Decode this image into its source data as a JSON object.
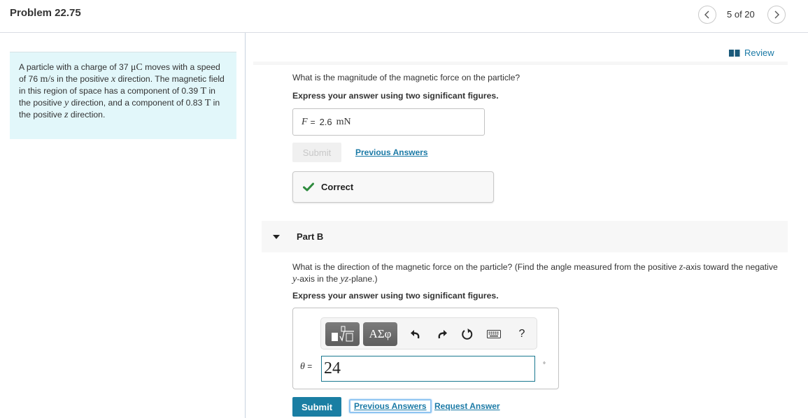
{
  "header": {
    "title": "Problem 22.75",
    "page_count": "5 of 20"
  },
  "problem": {
    "parts": [
      {
        "t": "text",
        "v": "A particle with a charge of 37 "
      },
      {
        "t": "math",
        "v": "μC"
      },
      {
        "t": "text",
        "v": " moves with a speed of 76 "
      },
      {
        "t": "math",
        "v": "m/s"
      },
      {
        "t": "text",
        "v": " in the positive "
      },
      {
        "t": "mathi",
        "v": "x"
      },
      {
        "t": "text",
        "v": " direction. The magnetic field in this region of space has a component of 0.39 "
      },
      {
        "t": "math",
        "v": "T"
      },
      {
        "t": "text",
        "v": " in the positive "
      },
      {
        "t": "mathi",
        "v": "y"
      },
      {
        "t": "text",
        "v": " direction, and a component of 0.83 "
      },
      {
        "t": "math",
        "v": "T"
      },
      {
        "t": "text",
        "v": " in the positive "
      },
      {
        "t": "mathi",
        "v": "z"
      },
      {
        "t": "text",
        "v": " direction."
      }
    ]
  },
  "review_label": "Review",
  "part_a": {
    "question": "What is the magnitude of the magnetic force on the particle?",
    "instruction": "Express your answer using two significant figures.",
    "answer": {
      "variable": "F",
      "equals": "=",
      "value": "2.6",
      "unit": "mN"
    },
    "submit_label": "Submit",
    "previous_answers_label": "Previous Answers",
    "feedback": "Correct",
    "feedback_color": "#2e8b3e"
  },
  "part_b": {
    "label": "Part B",
    "question_parts": [
      {
        "t": "text",
        "v": "What is the direction of the magnetic force on the particle? (Find the angle measured from the positive "
      },
      {
        "t": "mathi",
        "v": "z"
      },
      {
        "t": "text",
        "v": "-axis toward the negative "
      },
      {
        "t": "mathi",
        "v": "y"
      },
      {
        "t": "text",
        "v": "-axis in the "
      },
      {
        "t": "mathi",
        "v": "yz"
      },
      {
        "t": "text",
        "v": "-plane.)"
      }
    ],
    "instruction": "Express your answer using two significant figures.",
    "toolbar": {
      "templates_icon": "templates-icon",
      "symbols_label": "ΑΣφ",
      "undo_icon": "undo-icon",
      "redo_icon": "redo-icon",
      "reset_icon": "reset-icon",
      "keyboard_icon": "keyboard-icon",
      "help_label": "?"
    },
    "answer": {
      "variable": "θ",
      "equals": "=",
      "value": "24",
      "unit": "°"
    },
    "submit_label": "Submit",
    "previous_answers_label": "Previous Answers",
    "request_answer_label": "Request Answer"
  },
  "colors": {
    "accent": "#1a7ea3",
    "link": "#1b7aa6",
    "problem_bg": "#e2f7fa"
  }
}
